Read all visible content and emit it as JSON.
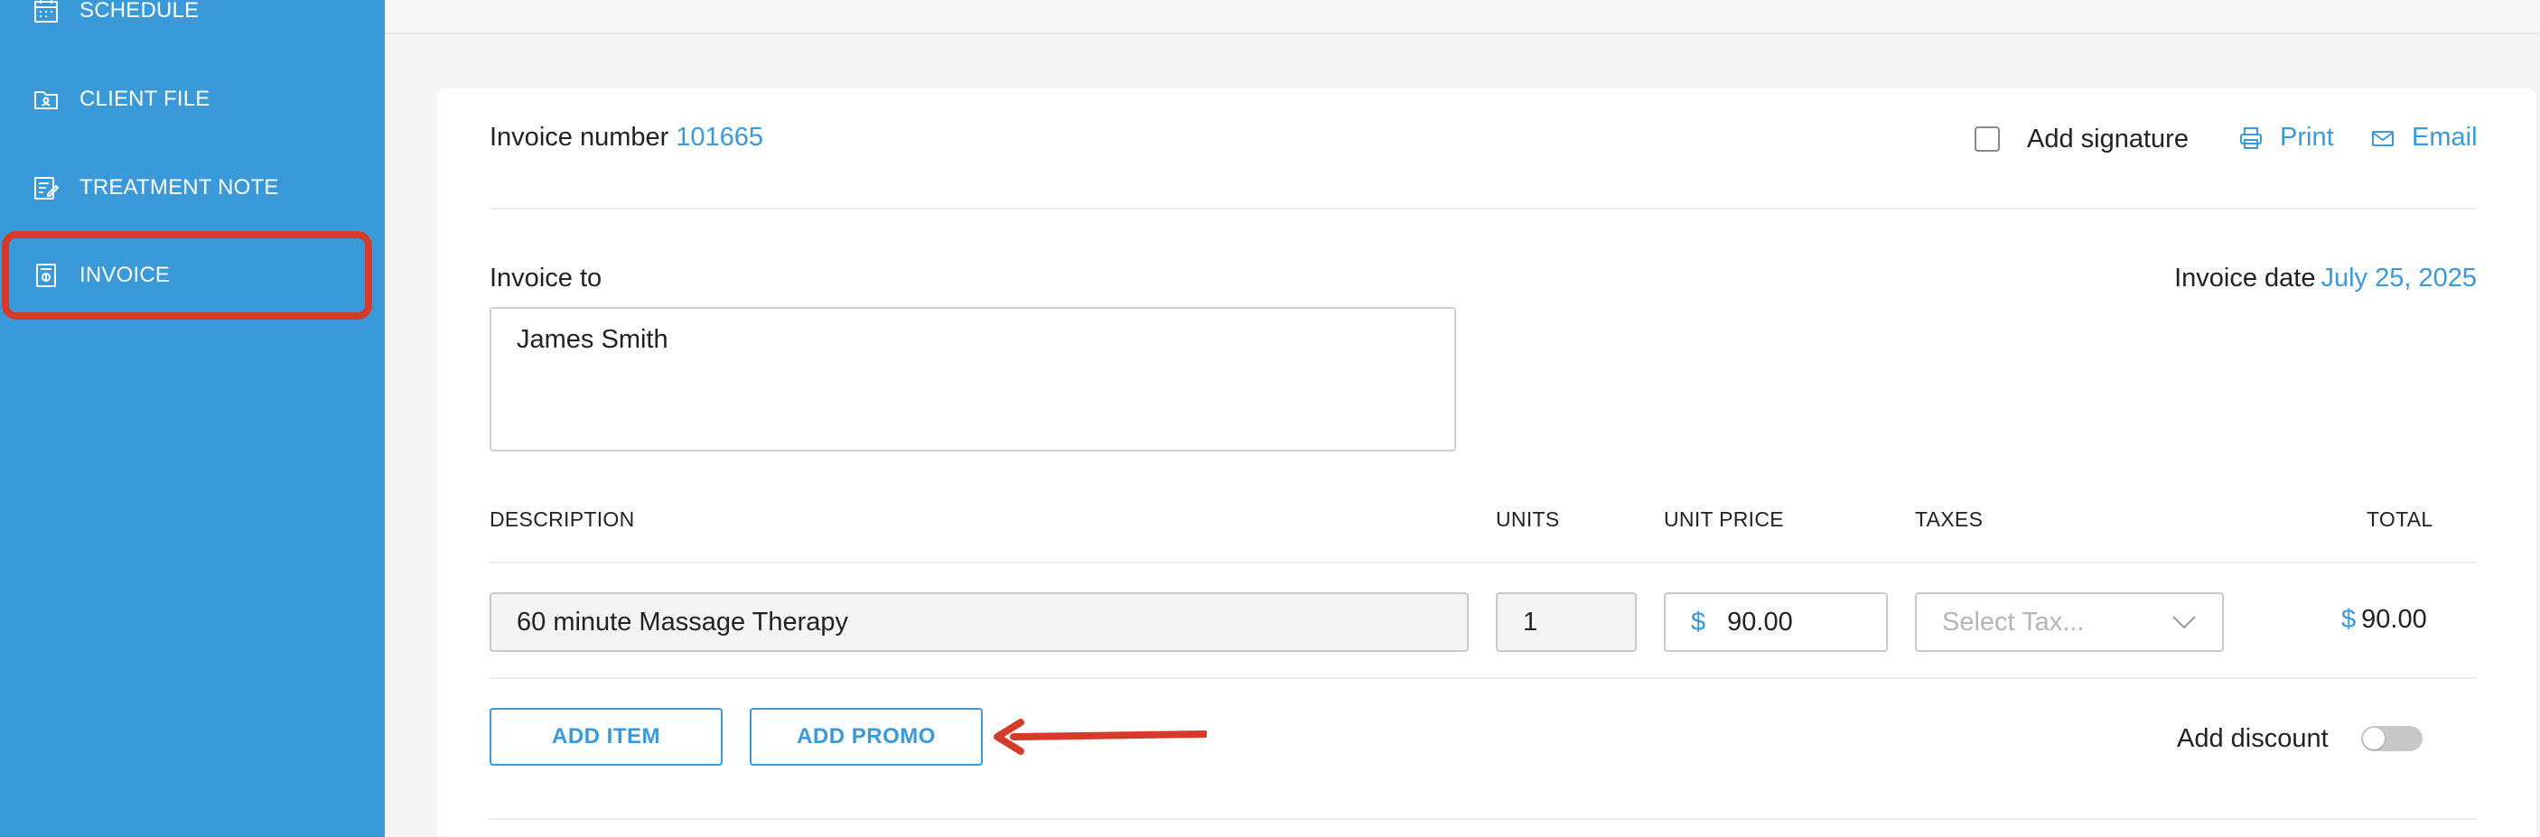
{
  "sidebar": {
    "items": [
      {
        "label": "SCHEDULE",
        "icon": "calendar-icon"
      },
      {
        "label": "CLIENT FILE",
        "icon": "client-file-icon"
      },
      {
        "label": "TREATMENT NOTE",
        "icon": "treatment-note-icon"
      },
      {
        "label": "INVOICE",
        "icon": "invoice-icon",
        "active": true
      }
    ],
    "background_color": "#3a9ad9",
    "highlight_color": "#d63a2a"
  },
  "invoice": {
    "number_label": "Invoice number",
    "number": "101665",
    "add_signature_label": "Add signature",
    "add_signature_checked": false,
    "print_label": "Print",
    "email_label": "Email",
    "invoice_to_label": "Invoice to",
    "invoice_to_value": "James Smith",
    "date_label": "Invoice date",
    "date": "July 25, 2025"
  },
  "items_table": {
    "headers": {
      "description": "DESCRIPTION",
      "units": "UNITS",
      "unit_price": "UNIT PRICE",
      "taxes": "TAXES",
      "total": "TOTAL"
    },
    "rows": [
      {
        "description": "60 minute Massage Therapy",
        "units": "1",
        "currency": "$",
        "unit_price": "90.00",
        "tax_placeholder": "Select Tax...",
        "total": "90.00"
      }
    ]
  },
  "actions": {
    "add_item_label": "ADD ITEM",
    "add_promo_label": "ADD PROMO",
    "add_discount_label": "Add discount",
    "add_discount_enabled": false
  },
  "colors": {
    "accent": "#3a9ad9",
    "annotation_arrow": "#d63a2a"
  }
}
